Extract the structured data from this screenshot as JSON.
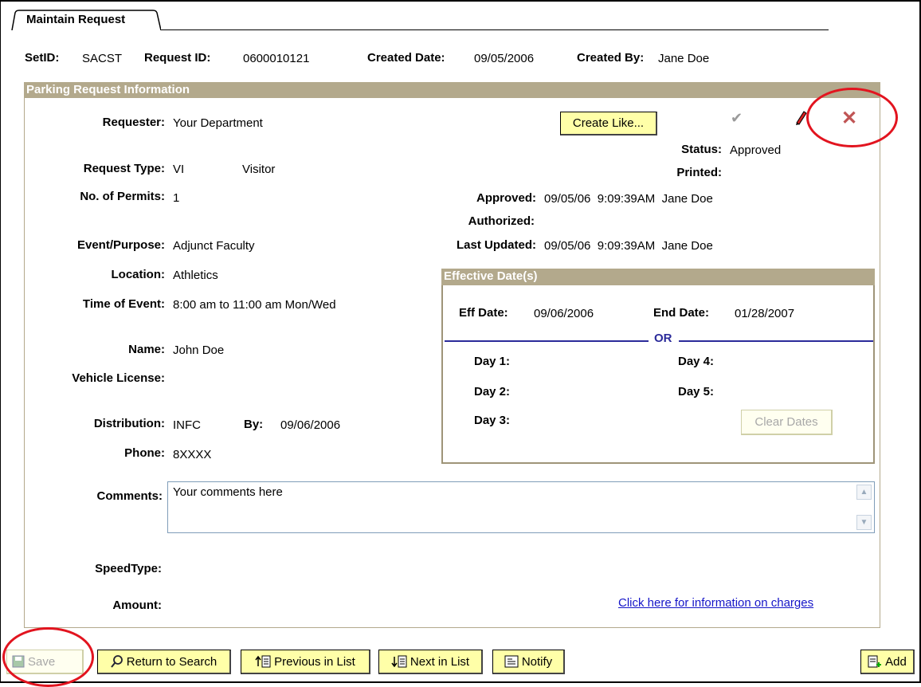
{
  "tab": {
    "label": "Maintain Request"
  },
  "header": {
    "setid_label": "SetID:",
    "setid": "SACST",
    "request_id_label": "Request ID:",
    "request_id": "0600010121",
    "created_date_label": "Created Date:",
    "created_date": "09/05/2006",
    "created_by_label": "Created By:",
    "created_by": "Jane Doe"
  },
  "section": {
    "title": "Parking Request Information"
  },
  "fields": {
    "requester_label": "Requester:",
    "requester": "Your Department",
    "request_type_label": "Request Type:",
    "request_type_code": "VI",
    "request_type": "Visitor",
    "permits_label": "No. of Permits:",
    "permits": "1",
    "event_label": "Event/Purpose:",
    "event": "Adjunct Faculty",
    "location_label": "Location:",
    "location": "Athletics",
    "time_label": "Time of Event:",
    "time": "8:00 am to 11:00 am Mon/Wed",
    "name_label": "Name:",
    "name": "John Doe",
    "vehicle_label": "Vehicle License:",
    "distribution_label": "Distribution:",
    "distribution": "INFC",
    "by_label": "By:",
    "by": "09/06/2006",
    "phone_label": "Phone:",
    "phone": "8XXXX",
    "comments_label": "Comments:",
    "comments": "Your comments here",
    "speedtype_label": "SpeedType:",
    "amount_label": "Amount:"
  },
  "status": {
    "create_like": "Create Like...",
    "status_label": "Status:",
    "status": "Approved",
    "printed_label": "Printed:",
    "approved_label": "Approved:",
    "approved": "09/05/06  9:09:39AM  Jane Doe",
    "authorized_label": "Authorized:",
    "updated_label": "Last Updated:",
    "updated": "09/05/06  9:09:39AM  Jane Doe"
  },
  "effective": {
    "title": "Effective Date(s)",
    "eff_label": "Eff Date:",
    "eff": "09/06/2006",
    "end_label": "End Date:",
    "end": "01/28/2007",
    "or": "OR",
    "day1": "Day 1:",
    "day2": "Day 2:",
    "day3": "Day 3:",
    "day4": "Day 4:",
    "day5": "Day 5:",
    "clear": "Clear Dates"
  },
  "charges_link": "Click here for information on charges",
  "toolbar": {
    "save": "Save",
    "return": "Return to Search",
    "previous": "Previous in List",
    "next": "Next in List",
    "notify": "Notify",
    "add": "Add"
  },
  "colors": {
    "section_bar": "#b3a98c",
    "button_bg": "#ffffa8",
    "highlight_circle": "#e2141f",
    "link": "#1515c8"
  }
}
